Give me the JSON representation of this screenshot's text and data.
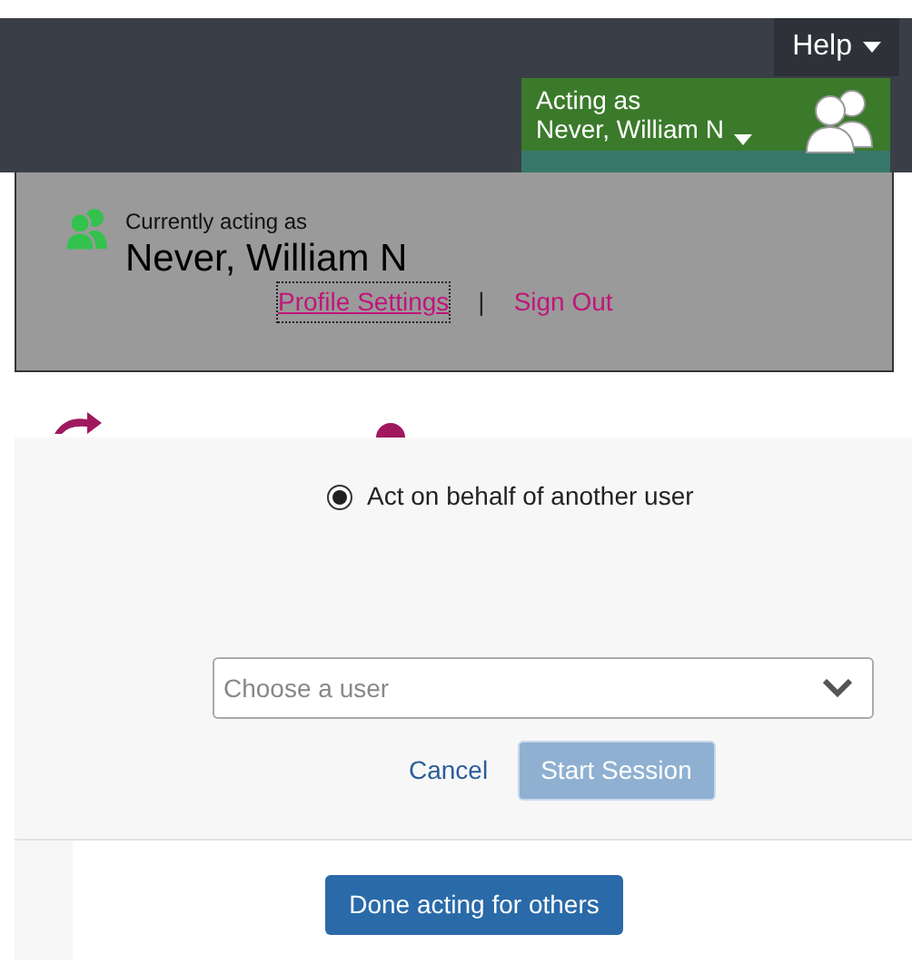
{
  "header": {
    "help": "Help",
    "acting_label": "Acting as",
    "acting_name": "Never, William N"
  },
  "panel": {
    "caption": "Currently acting as",
    "name": "Never, William N",
    "links": [
      "Profile Settings",
      "Sign Out"
    ],
    "separator": "|"
  },
  "options": [
    {
      "label": "Act on behalf of another user",
      "selected": true
    }
  ],
  "user_select": {
    "placeholder": "Choose a user"
  },
  "actions": {
    "cancel": "Cancel",
    "start": {
      "label": "Start Session",
      "disabled": true
    }
  },
  "done_button": "Done acting for others"
}
